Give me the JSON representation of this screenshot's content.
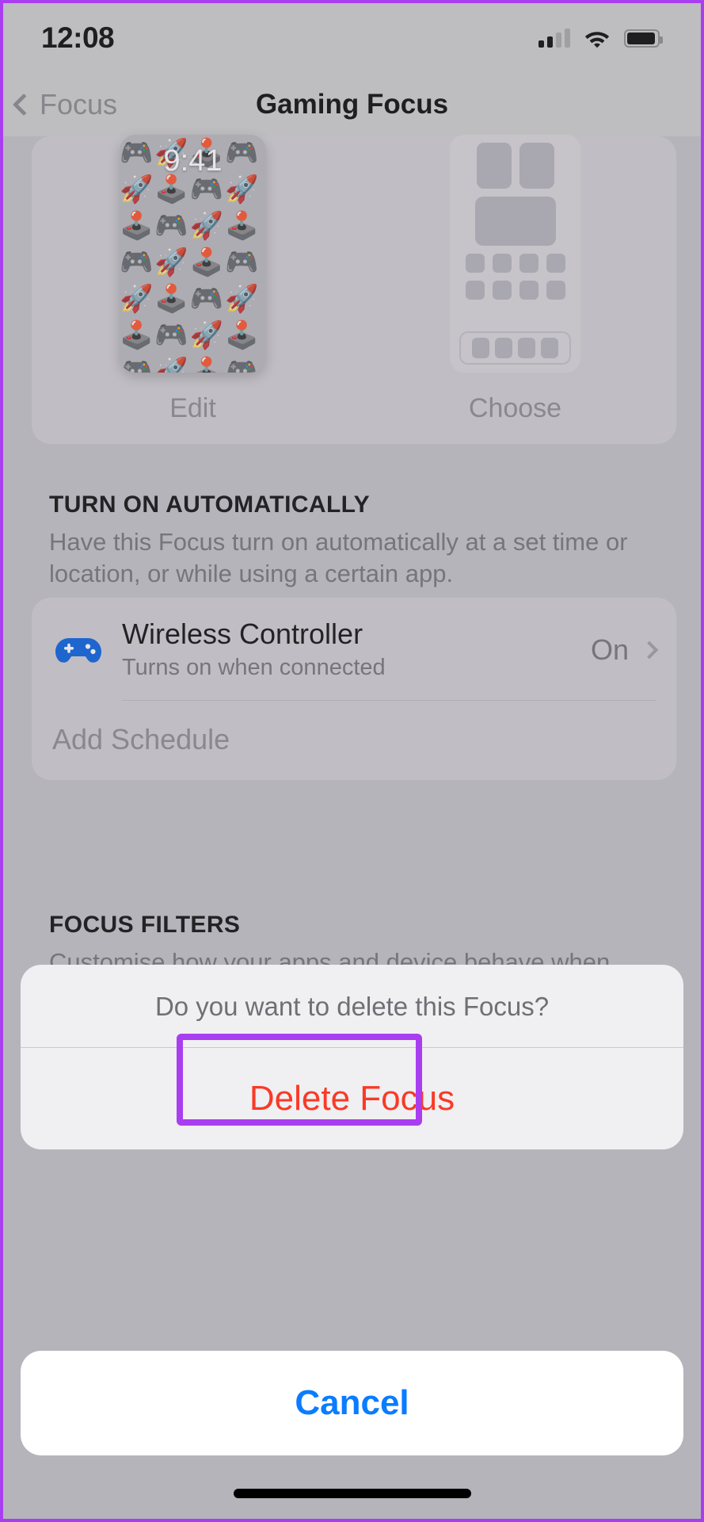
{
  "status_bar": {
    "time": "12:08",
    "signal_icon": "cellular-signal-icon",
    "wifi_icon": "wifi-icon",
    "battery_icon": "battery-icon"
  },
  "nav_bar": {
    "back_label": "Focus",
    "back_icon": "chevron-left-icon",
    "title": "Gaming Focus"
  },
  "previews": {
    "lock_screen": {
      "time": "9:41",
      "wallpaper_emoji": "🎮🚀🕹️🎮🚀🕹️🎮🚀🕹️🎮🚀🕹️🎮🚀🕹️🎮🚀🕹️🎮🚀🕹️🎮🚀🕹️🎮🚀🕹️🎮🚀🕹️🎮🚀🕹️🎮🚀🕹️",
      "label": "Edit"
    },
    "home_screen": {
      "label": "Choose"
    }
  },
  "turn_on_automatically": {
    "header": "TURN ON AUTOMATICALLY",
    "description": "Have this Focus turn on automatically at a set time or location, or while using a certain app.",
    "rows": [
      {
        "icon": "game-controller-icon",
        "icon_color": "#0a63e0",
        "title": "Wireless Controller",
        "subtitle": "Turns on when connected",
        "value": "On",
        "accessory_icon": "chevron-right-icon"
      }
    ],
    "add_schedule_label": "Add Schedule"
  },
  "focus_filters": {
    "header": "FOCUS FILTERS",
    "description": "Customise how your apps and device behave when this Focus is on.",
    "add_icon": "plus-icon"
  },
  "action_sheet": {
    "title": "Do you want to delete this Focus?",
    "destructive_label": "Delete Focus",
    "destructive_color": "#f93a26",
    "cancel_label": "Cancel",
    "cancel_color": "#0a7cff"
  },
  "annotation": {
    "highlight_color": "#a93ef0",
    "target": "Delete Focus"
  }
}
